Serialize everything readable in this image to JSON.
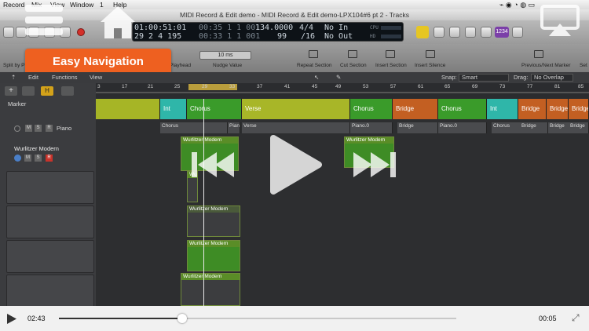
{
  "menubar": {
    "items": [
      "Record",
      "Mix",
      "View",
      "Window",
      "1",
      "Help"
    ]
  },
  "window": {
    "title": "MIDI Record & Edit demo - MIDI Record & Edit demo-LPX104#6 pt 2 - Tracks"
  },
  "lcd": {
    "position_time": "01:00:51:01",
    "position_bars": "29 2 4 195",
    "end_1": "00:35 1 1 001",
    "end_2": "00:33 1 1 001",
    "tempo": "134.0000",
    "signature": "4/4",
    "division": "/16",
    "beats": "99",
    "in_label": "No In",
    "out_label": "No Out",
    "cpu_label": "CPU",
    "hd_label": "HD"
  },
  "counter_badge": "1234",
  "toolbar": {
    "split_label": "Split by P",
    "playhead_label": "Playhead",
    "nudge_value": "10 ms",
    "nudge_label": "Nudge Value",
    "repeat_label": "Repeat Section",
    "cut_label": "Cut Section",
    "insert_label": "Insert Section",
    "insert_silence_label": "Insert Silence",
    "prev_next_label": "Previous/Next Marker",
    "set_label": "Set"
  },
  "tracks_header": {
    "edit": "Edit",
    "functions": "Functions",
    "view": "View",
    "snap_label": "Snap:",
    "snap_value": "Smart",
    "drag_label": "Drag:",
    "drag_value": "No Overlap"
  },
  "ruler_ticks": [
    "3",
    "17",
    "21",
    "25",
    "29",
    "33",
    "37",
    "41",
    "45",
    "49",
    "53",
    "57",
    "61",
    "65",
    "69",
    "73",
    "77",
    "81",
    "85"
  ],
  "global_tracks": {
    "marker_label": "Marker",
    "piano_label": "Piano"
  },
  "track": {
    "name": "Wurlitzer Modern"
  },
  "markers": [
    {
      "label": "",
      "color": "#a6b526"
    },
    {
      "label": "Int",
      "color": "#2fb6a9"
    },
    {
      "label": "Chorus",
      "color": "#3a9b2a"
    },
    {
      "label": "Verse",
      "color": "#a8b628"
    },
    {
      "label": "Chorus",
      "color": "#3a9b2a"
    },
    {
      "label": "Bridge",
      "color": "#c35f22"
    },
    {
      "label": "Chorus",
      "color": "#3a9b2a"
    },
    {
      "label": "Int",
      "color": "#2fb6a9"
    },
    {
      "label": "Bridge",
      "color": "#c35f22"
    },
    {
      "label": "Bridge",
      "color": "#c35f22"
    },
    {
      "label": "Bridge",
      "color": "#c35f22"
    }
  ],
  "sections": [
    "Chorus",
    "Piano",
    "Verse",
    "Piano.0",
    "Bridge",
    "Piano.0",
    "Chorus",
    "Bridge",
    "Bridge",
    "Bridge"
  ],
  "regions": {
    "main_top": "Wurlitzer Modern",
    "small": "Wurl",
    "lane2": "Wurlitzer Modern",
    "lane3": "Wurlitzer Modern",
    "lane4": "Wurlitzer Modern",
    "right": "Wurlitzer Modern"
  },
  "overlay": {
    "easy_navigation": "Easy Navigation"
  },
  "player": {
    "elapsed": "02:43",
    "remaining": "00:05",
    "progress": 0.31
  }
}
